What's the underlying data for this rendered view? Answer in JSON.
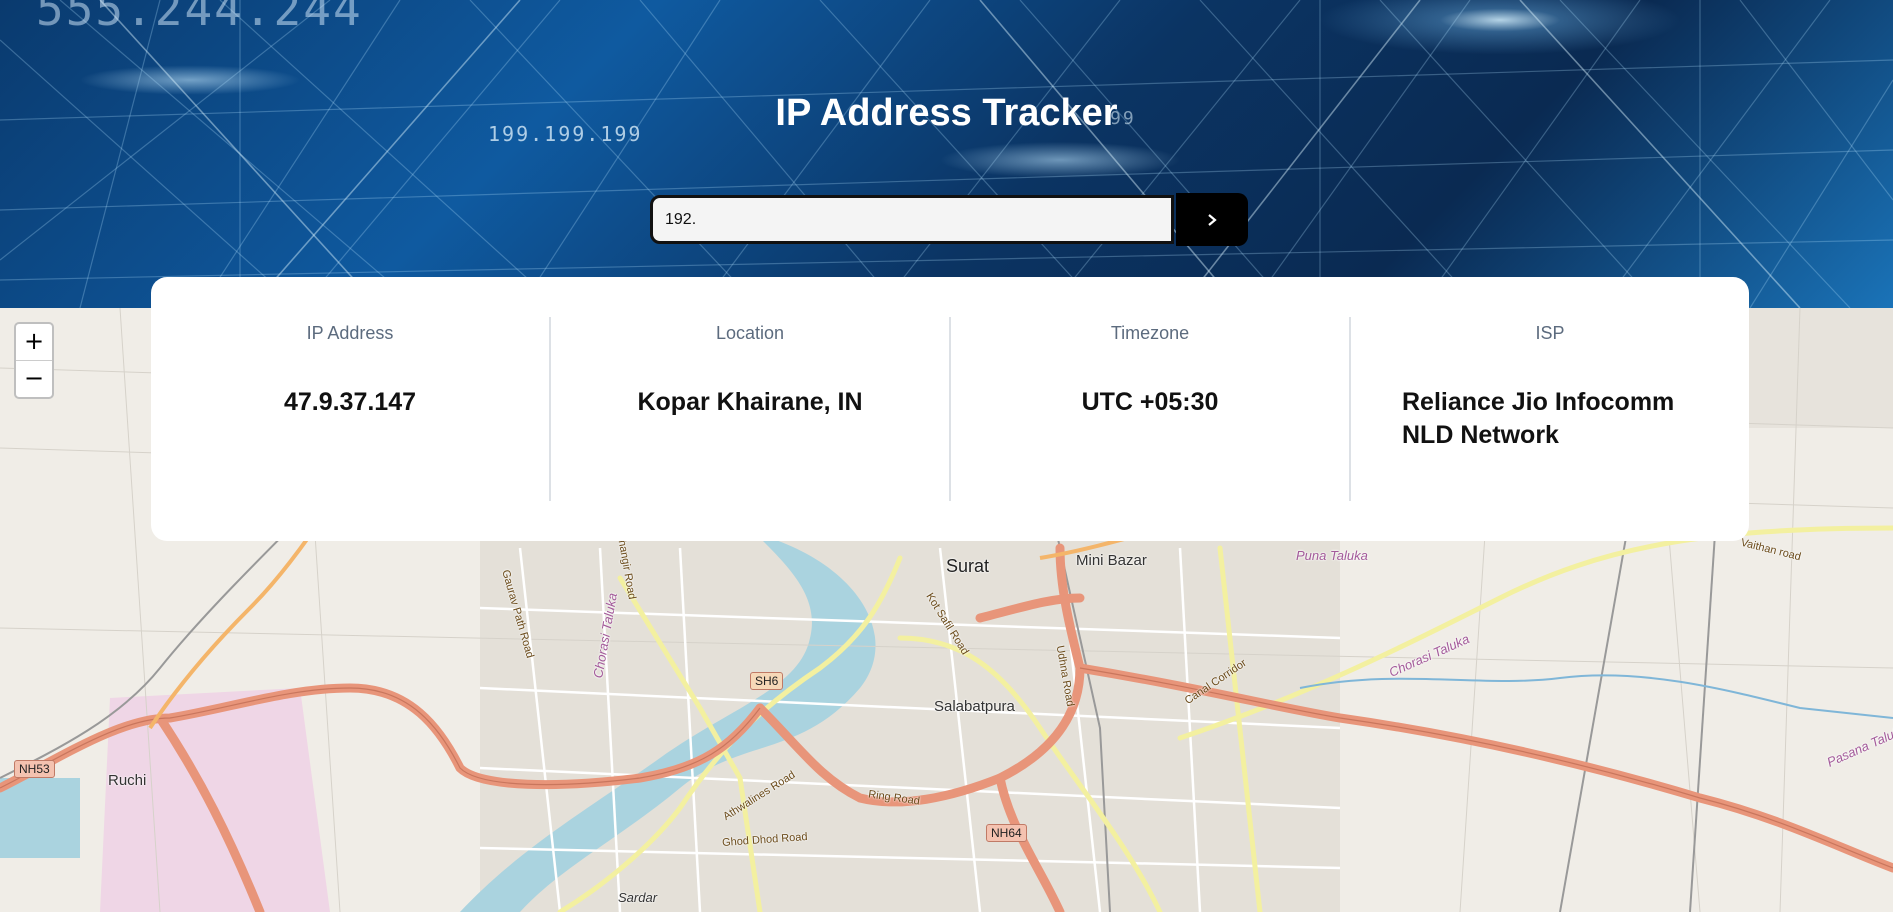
{
  "hero": {
    "title": "IP Address Tracker",
    "background_digits": [
      "555.244.244",
      "199.199.199",
      "99"
    ]
  },
  "search": {
    "value": "192.",
    "placeholder": "",
    "submit_icon": "chevron-right-icon"
  },
  "info": {
    "ip_address": {
      "label": "IP Address",
      "value": "47.9.37.147"
    },
    "location": {
      "label": "Location",
      "value": "Kopar Khairane, IN"
    },
    "timezone": {
      "label": "Timezone",
      "value": "UTC +05:30"
    },
    "isp": {
      "label": "ISP",
      "value": "Reliance Jio Infocomm NLD Network"
    }
  },
  "map": {
    "zoom_in": "+",
    "zoom_out": "−",
    "places": {
      "surat": "Surat",
      "mini_bazar": "Mini Bazar",
      "salabatpura": "Salabatpura",
      "ruchi": "Ruchi",
      "sardar": "Sardar",
      "puna_taluka": "Puna Taluka",
      "chorasi_taluka": "Chorasi Taluka",
      "chorasi_taluka_left": "Chorasi Taluka",
      "pasana_taluka": "Pasana Taluka"
    },
    "roads": {
      "gaurav_path": "Gaurav Path Road",
      "jahangir": "Jahangir Road",
      "ring_road": "Ring Road",
      "athwalines": "Athwalines Road",
      "ghod_dhod": "Ghod Dhod Road",
      "canal_corridor": "Canal Corridor",
      "vaithan": "Vaithan road",
      "kot_safil": "Kot Safil Road",
      "udhna": "Udhna Road"
    },
    "shields": {
      "sh6": "SH6",
      "nh53": "NH53",
      "nh64": "NH64"
    },
    "colors": {
      "primary_road": "#e8957a",
      "secondary_road": "#f3f0a0",
      "river": "#aad3df",
      "land": "#f0ede7",
      "urban": "#e4e0d8",
      "industrial": "#efd6e6"
    }
  }
}
